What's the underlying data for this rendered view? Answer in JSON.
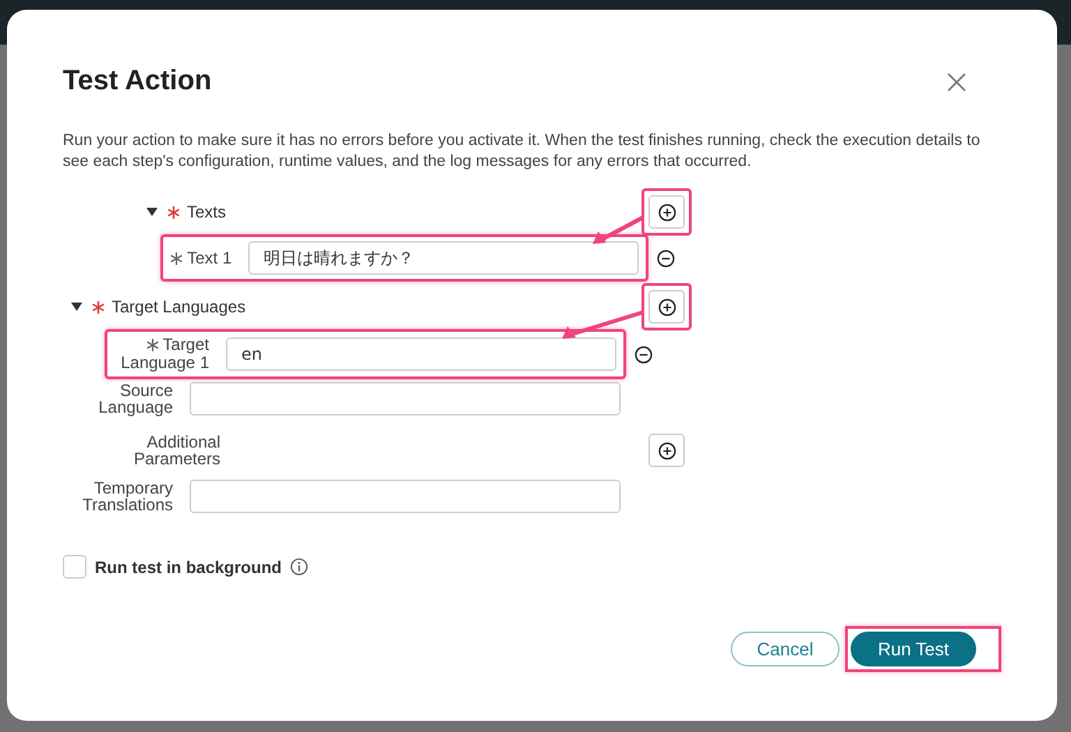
{
  "dialog": {
    "title": "Test Action",
    "description": "Run your action to make sure it has no errors before you activate it. When the test finishes running, check the execution details to see each step's configuration, runtime values, and the log messages for any errors that occurred."
  },
  "form": [
    {
      "kind": "group",
      "label": "Texts",
      "required": true,
      "expanded": true,
      "add_highlighted": true,
      "children": [
        {
          "kind": "field",
          "label": "Text 1",
          "required": true,
          "value": "明日は晴れますか？",
          "highlighted": true,
          "removable": true
        }
      ]
    },
    {
      "kind": "group",
      "label": "Target Languages",
      "required": true,
      "expanded": true,
      "add_highlighted": true,
      "children": [
        {
          "kind": "field",
          "label": "Target Language 1",
          "required": true,
          "value": "en",
          "highlighted": true,
          "removable": true
        }
      ]
    },
    {
      "kind": "field",
      "label": "Source Language"
    },
    {
      "kind": "list",
      "label": "Additional Parameters"
    },
    {
      "kind": "field",
      "label": "Temporary Translations"
    }
  ],
  "background_option": {
    "label": "Run test in background",
    "checked": false
  },
  "buttons": [
    {
      "label": "Cancel",
      "kind": "secondary",
      "highlighted": false
    },
    {
      "label": "Run Test",
      "kind": "primary",
      "highlighted": true
    }
  ]
}
